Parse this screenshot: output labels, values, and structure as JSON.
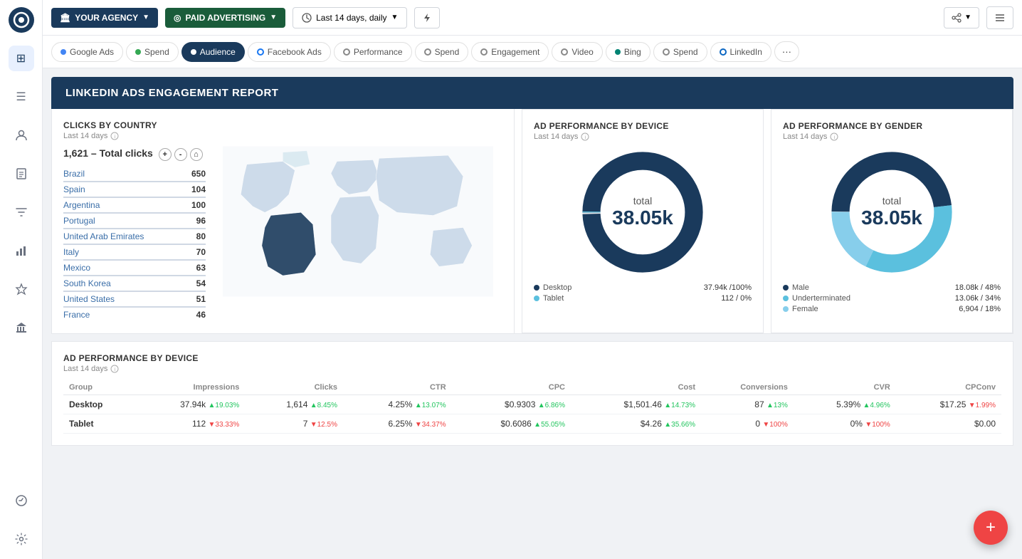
{
  "app": {
    "logo": "●"
  },
  "topbar": {
    "agency_label": "YOUR AGENCY",
    "source_label": "PAID ADVERTISING",
    "date_label": "Last 14 days, daily",
    "agency_icon": "🏛",
    "source_icon": "◎"
  },
  "tabs": [
    {
      "id": "google-ads",
      "label": "Google Ads",
      "active": false,
      "dot_color": "#4285F4"
    },
    {
      "id": "spend1",
      "label": "Spend",
      "active": false,
      "dot_color": "#34a853"
    },
    {
      "id": "audience",
      "label": "Audience",
      "active": true,
      "dot_color": "#fff"
    },
    {
      "id": "facebook-ads",
      "label": "Facebook Ads",
      "active": false,
      "dot_color": "#1877F2"
    },
    {
      "id": "performance",
      "label": "Performance",
      "active": false,
      "dot_color": "#666"
    },
    {
      "id": "spend2",
      "label": "Spend",
      "active": false,
      "dot_color": "#666"
    },
    {
      "id": "engagement",
      "label": "Engagement",
      "active": false,
      "dot_color": "#666"
    },
    {
      "id": "video",
      "label": "Video",
      "active": false,
      "dot_color": "#666"
    },
    {
      "id": "bing",
      "label": "Bing",
      "active": false,
      "dot_color": "#008373"
    },
    {
      "id": "spend3",
      "label": "Spend",
      "active": false,
      "dot_color": "#666"
    },
    {
      "id": "linkedin",
      "label": "LinkedIn",
      "active": false,
      "dot_color": "#0A66C2"
    }
  ],
  "report": {
    "title": "LINKEDIN ADS ENGAGEMENT REPORT"
  },
  "clicks_by_country": {
    "title": "CLICKS BY COUNTRY",
    "subtitle": "Last 14 days",
    "total_label": "1,621 – Total clicks",
    "countries": [
      {
        "name": "Brazil",
        "value": "650"
      },
      {
        "name": "Spain",
        "value": "104"
      },
      {
        "name": "Argentina",
        "value": "100"
      },
      {
        "name": "Portugal",
        "value": "96"
      },
      {
        "name": "United Arab Emirates",
        "value": "80"
      },
      {
        "name": "Italy",
        "value": "70"
      },
      {
        "name": "Mexico",
        "value": "63"
      },
      {
        "name": "South Korea",
        "value": "54"
      },
      {
        "name": "United States",
        "value": "51"
      },
      {
        "name": "France",
        "value": "46"
      }
    ]
  },
  "ad_perf_device_donut": {
    "title": "AD PERFORMANCE BY DEVICE",
    "subtitle": "Last 14 days",
    "total_label": "total",
    "total_value": "38.05k",
    "legend": [
      {
        "label": "Desktop",
        "value": "37.94k / 100%",
        "color": "#1a3a5c"
      },
      {
        "label": "Tablet",
        "value": "112 /   0%",
        "color": "#5bc0de"
      }
    ],
    "segments": [
      {
        "pct": 99.7,
        "color": "#1a3a5c"
      },
      {
        "pct": 0.3,
        "color": "#5bc0de"
      }
    ]
  },
  "ad_perf_gender_donut": {
    "title": "AD PERFORMANCE BY GENDER",
    "subtitle": "Last 14 days",
    "total_label": "total",
    "total_value": "38.05k",
    "legend": [
      {
        "label": "Male",
        "value": "18.08k / 48%",
        "color": "#1a3a5c"
      },
      {
        "label": "Underterminated",
        "value": "13.06k / 34%",
        "color": "#5bc0de"
      },
      {
        "label": "Female",
        "value": "6,904 / 18%",
        "color": "#87ceeb"
      }
    ],
    "segments": [
      {
        "pct": 48,
        "color": "#1a3a5c"
      },
      {
        "pct": 34,
        "color": "#5bc0de"
      },
      {
        "pct": 18,
        "color": "#87ceeb"
      }
    ]
  },
  "ad_perf_table": {
    "title": "AD PERFORMANCE BY DEVICE",
    "subtitle": "Last 14 days",
    "columns": [
      "Group",
      "Impressions",
      "Clicks",
      "CTR",
      "CPC",
      "Cost",
      "Conversions",
      "CVR",
      "CPConv"
    ],
    "rows": [
      {
        "group": "Desktop",
        "impressions": "37.94k",
        "impressions_change": "+19.03%",
        "impressions_up": true,
        "clicks": "1,614",
        "clicks_change": "+8.45%",
        "clicks_up": true,
        "ctr": "4.25%",
        "ctr_change": "+13.07%",
        "ctr_up": true,
        "cpc": "$0.9303",
        "cpc_change": "+6.86%",
        "cpc_up": false,
        "cost": "$1,501.46",
        "cost_change": "+14.73%",
        "cost_up": false,
        "conversions": "87",
        "conversions_change": "+13%",
        "conversions_up": true,
        "cvr": "5.39%",
        "cvr_change": "+4.96%",
        "cvr_up": true,
        "cpconv": "$17.25",
        "cpconv_change": "+1.99%",
        "cpconv_up": false
      },
      {
        "group": "Tablet",
        "impressions": "112",
        "impressions_change": "+33.33%",
        "impressions_up": false,
        "clicks": "7",
        "clicks_change": "+12.5%",
        "clicks_up": false,
        "ctr": "6.25%",
        "ctr_change": "+34.37%",
        "ctr_up": false,
        "cpc": "$0.6086",
        "cpc_change": "+55.05%",
        "cpc_up": false,
        "cost": "$4.26",
        "cost_change": "+35.66%",
        "cost_up": false,
        "conversions": "0",
        "conversions_change": "+100%",
        "conversions_up": false,
        "cvr": "0%",
        "cvr_change": "+100%",
        "cvr_up": false,
        "cpconv": "$0.00",
        "cpconv_change": "",
        "cpconv_up": false
      }
    ]
  },
  "sidebar": {
    "items": [
      {
        "id": "logo",
        "icon": "●"
      },
      {
        "id": "grid",
        "icon": "⊞"
      },
      {
        "id": "list",
        "icon": "☰"
      },
      {
        "id": "user",
        "icon": "○"
      },
      {
        "id": "report",
        "icon": "▤"
      },
      {
        "id": "filter",
        "icon": "⫶"
      },
      {
        "id": "chart",
        "icon": "▦"
      },
      {
        "id": "star",
        "icon": "★"
      },
      {
        "id": "bank",
        "icon": "⊟"
      },
      {
        "id": "settings",
        "icon": "⚙"
      }
    ]
  },
  "fab": {
    "icon": "+"
  }
}
